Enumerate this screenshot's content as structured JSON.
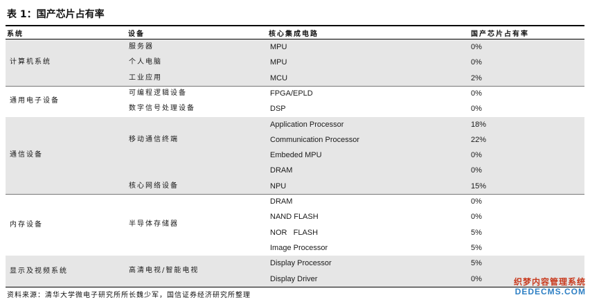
{
  "title": "表 1：国产芯片占有率",
  "headers": {
    "system": "系统",
    "device": "设备",
    "core_ic": "核心集成电路",
    "share": "国产芯片占有率"
  },
  "groups": [
    {
      "system": "计算机系统",
      "shaded": true,
      "devices": [
        "服务器",
        "个人电脑",
        "工业应用"
      ],
      "rows": [
        {
          "ic": "MPU",
          "share": "0%"
        },
        {
          "ic": "MPU",
          "share": "0%"
        },
        {
          "ic": "MCU",
          "share": "2%"
        }
      ]
    },
    {
      "system": "通用电子设备",
      "shaded": false,
      "devices": [
        "可编程逻辑设备",
        "数字信号处理设备"
      ],
      "rows": [
        {
          "ic": "FPGA/EPLD",
          "share": "0%"
        },
        {
          "ic": "DSP",
          "share": "0%"
        }
      ]
    },
    {
      "system": "通信设备",
      "shaded": true,
      "devices": [
        "移动通信终端",
        "核心网络设备"
      ],
      "rows": [
        {
          "ic": "Application Processor",
          "share": "18%"
        },
        {
          "ic": "Communication Processor",
          "share": "22%"
        },
        {
          "ic": "Embeded MPU",
          "share": "0%"
        },
        {
          "ic": "DRAM",
          "share": "0%"
        },
        {
          "ic": "NPU",
          "share": "15%"
        }
      ]
    },
    {
      "system": "内存设备",
      "shaded": false,
      "devices": [
        "半导体存储器"
      ],
      "rows": [
        {
          "ic": "DRAM",
          "share": "0%"
        },
        {
          "ic": "NAND FLASH",
          "share": "0%"
        },
        {
          "ic": "NOR   FLASH",
          "share": "5%"
        },
        {
          "ic": "Image Processor",
          "share": "5%"
        }
      ]
    },
    {
      "system": "显示及视频系统",
      "shaded": true,
      "devices": [
        "高清电视/智能电视"
      ],
      "rows": [
        {
          "ic": "Display Processor",
          "share": "5%"
        },
        {
          "ic": "Display Driver",
          "share": "0%"
        }
      ]
    }
  ],
  "source": "资料来源：清华大学微电子研究所所长魏少军，国信证券经济研究所整理",
  "watermark": {
    "line1": "织梦内容管理系统",
    "line2": "DEDECMS.COM"
  }
}
